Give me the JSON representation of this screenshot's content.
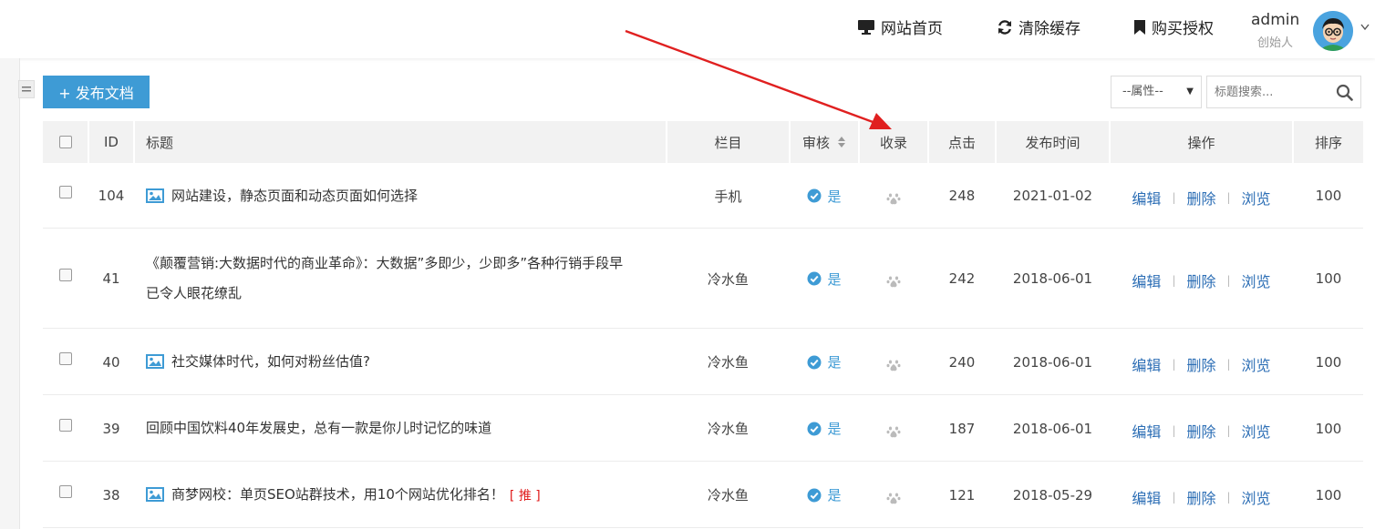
{
  "header": {
    "nav_home": "网站首页",
    "nav_cache": "清除缓存",
    "nav_buy": "购买授权",
    "user_name": "admin",
    "user_role": "创始人"
  },
  "toolbar": {
    "publish_label": "+ 发布文档",
    "attribute_select": "--属性--",
    "search_placeholder": "标题搜索..."
  },
  "table": {
    "columns": {
      "id": "ID",
      "title": "标题",
      "category": "栏目",
      "review": "审核",
      "indexed": "收录",
      "clicks": "点击",
      "publish_time": "发布时间",
      "actions": "操作",
      "sort": "排序"
    },
    "rows": [
      {
        "id": "104",
        "title_line1": "网站建设，静态页面和动态页面如何选择",
        "title_line2": "",
        "has_image": true,
        "tag": "",
        "category": "手机",
        "review": "是",
        "clicks": "248",
        "date": "2021-01-02",
        "sort": "100"
      },
      {
        "id": "41",
        "title_line1": "《颠覆营销:大数据时代的商业革命》：大数据”多即少，少即多”各种行销手段早",
        "title_line2": "已令人眼花缭乱",
        "has_image": false,
        "tag": "",
        "category": "冷水鱼",
        "review": "是",
        "clicks": "242",
        "date": "2018-06-01",
        "sort": "100"
      },
      {
        "id": "40",
        "title_line1": "社交媒体时代，如何对粉丝估值?",
        "title_line2": "",
        "has_image": true,
        "tag": "",
        "category": "冷水鱼",
        "review": "是",
        "clicks": "240",
        "date": "2018-06-01",
        "sort": "100"
      },
      {
        "id": "39",
        "title_line1": "回顾中国饮料40年发展史，总有一款是你儿时记忆的味道",
        "title_line2": "",
        "has_image": false,
        "tag": "",
        "category": "冷水鱼",
        "review": "是",
        "clicks": "187",
        "date": "2018-06-01",
        "sort": "100"
      },
      {
        "id": "38",
        "title_line1": "商梦网校：单页SEO站群技术，用10个网站优化排名！",
        "title_line2": "",
        "has_image": true,
        "tag": "[ 推 ]",
        "category": "冷水鱼",
        "review": "是",
        "clicks": "121",
        "date": "2018-05-29",
        "sort": "100"
      }
    ],
    "action_labels": {
      "edit": "编辑",
      "delete": "删除",
      "view": "浏览"
    }
  },
  "colors": {
    "accent": "#3e9bd5",
    "link": "#2c6eb5",
    "recommend": "#e01b1b",
    "annotation_arrow": "#e02020"
  }
}
